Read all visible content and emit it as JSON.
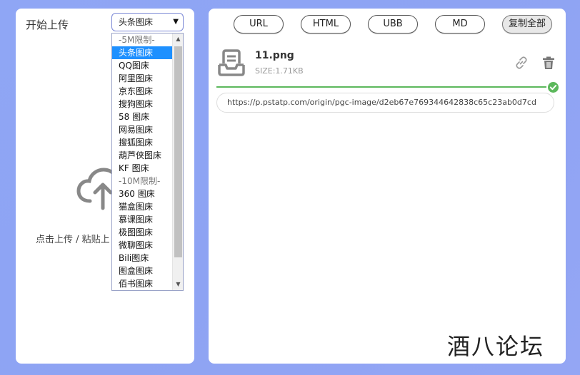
{
  "left": {
    "title": "开始上传",
    "select_value": "头条图床",
    "upload_hint": "点击上传 / 粘贴上"
  },
  "dropdown": {
    "options": [
      {
        "label": "-5M限制-",
        "group": true
      },
      {
        "label": "头条图床",
        "selected": true
      },
      {
        "label": "QQ图床"
      },
      {
        "label": "阿里图床"
      },
      {
        "label": "京东图床"
      },
      {
        "label": "搜狗图床"
      },
      {
        "label": "58 图床"
      },
      {
        "label": "网易图床"
      },
      {
        "label": "搜狐图床"
      },
      {
        "label": "葫芦侠图床"
      },
      {
        "label": "KF 图床"
      },
      {
        "label": "-10M限制-",
        "group": true
      },
      {
        "label": "360 图床"
      },
      {
        "label": "猫盒图床"
      },
      {
        "label": "慕课图床"
      },
      {
        "label": "极图图床"
      },
      {
        "label": "微聊图床"
      },
      {
        "label": "Bili图床"
      },
      {
        "label": "图盒图床"
      },
      {
        "label": "佰书图床"
      }
    ]
  },
  "toolbar": {
    "url_label": "URL",
    "html_label": "HTML",
    "ubb_label": "UBB",
    "md_label": "MD",
    "copy_all_label": "复制全部"
  },
  "file": {
    "name": "11.png",
    "size": "SIZE:1.71KB",
    "progress_percent": 100,
    "url": "https://p.pstatp.com/origin/pgc-image/d2eb67e769344642838c65c23ab0d7cd"
  },
  "watermark": "酒八论坛",
  "colors": {
    "accent": "#1e90ff",
    "success": "#5cb85c",
    "background": "#8fa6f5"
  }
}
